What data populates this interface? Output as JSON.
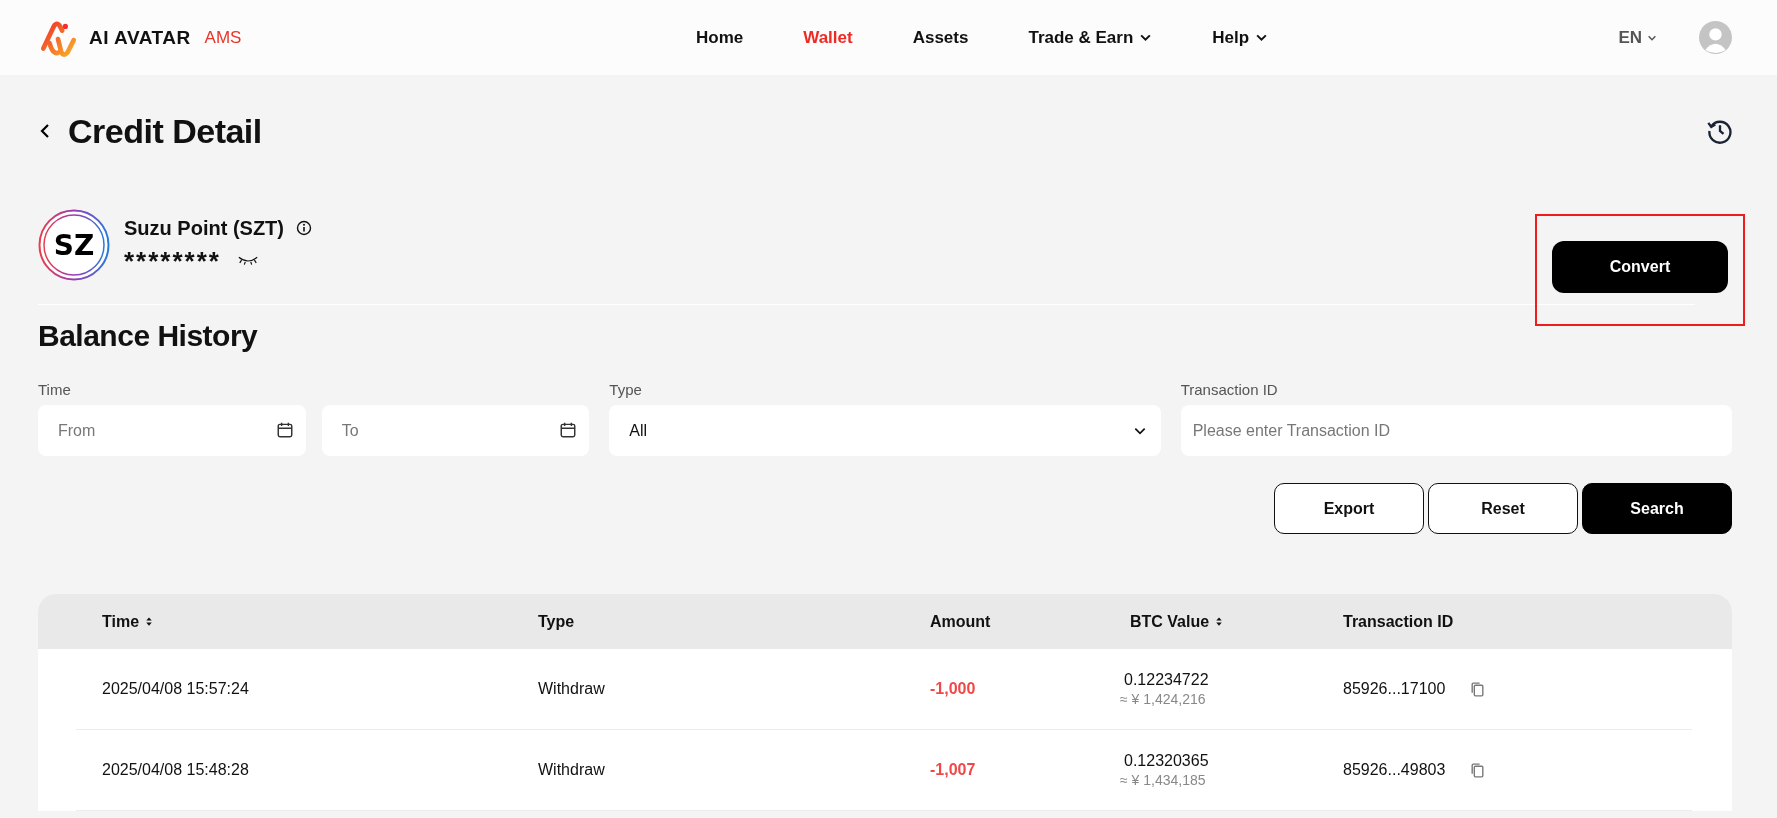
{
  "header": {
    "brand": "AI AVATAR",
    "brand_tag": "AMS",
    "nav": [
      {
        "label": "Home",
        "selected": false,
        "dropdown": false
      },
      {
        "label": "Wallet",
        "selected": true,
        "dropdown": false
      },
      {
        "label": "Assets",
        "selected": false,
        "dropdown": false
      },
      {
        "label": "Trade & Earn",
        "selected": false,
        "dropdown": true
      },
      {
        "label": "Help",
        "selected": false,
        "dropdown": true
      }
    ],
    "language": "EN"
  },
  "page_title": "Credit Detail",
  "token": {
    "logo_text": "SZ",
    "name": "Suzu Point (SZT)",
    "balance": "********"
  },
  "convert_button": {
    "label": "Convert",
    "highlighted": true
  },
  "section_title": "Balance History",
  "filters": {
    "time": {
      "label": "Time",
      "from_placeholder": "From",
      "to_placeholder": "To"
    },
    "type": {
      "label": "Type",
      "value": "All"
    },
    "transaction_id": {
      "label": "Transaction ID",
      "placeholder": "Please enter Transaction ID"
    }
  },
  "actions": [
    {
      "label": "Export",
      "kind": "outline"
    },
    {
      "label": "Reset",
      "kind": "outline"
    },
    {
      "label": "Search",
      "kind": "primary"
    }
  ],
  "table": {
    "columns": [
      {
        "label": "Time",
        "sortable": true
      },
      {
        "label": "Type",
        "sortable": false
      },
      {
        "label": "Amount",
        "sortable": false
      },
      {
        "label": "BTC Value",
        "sortable": true
      },
      {
        "label": "Transaction ID",
        "sortable": false
      }
    ],
    "rows": [
      {
        "time": "2025/04/08 15:57:24",
        "type": "Withdraw",
        "amount": "-1,000",
        "btc_value": "0.12234722",
        "fiat_value": "≈ ¥ 1,424,216",
        "transaction_id": "85926...17100"
      },
      {
        "time": "2025/04/08 15:48:28",
        "type": "Withdraw",
        "amount": "-1,007",
        "btc_value": "0.12320365",
        "fiat_value": "≈ ¥ 1,434,185",
        "transaction_id": "85926...49803"
      }
    ]
  }
}
